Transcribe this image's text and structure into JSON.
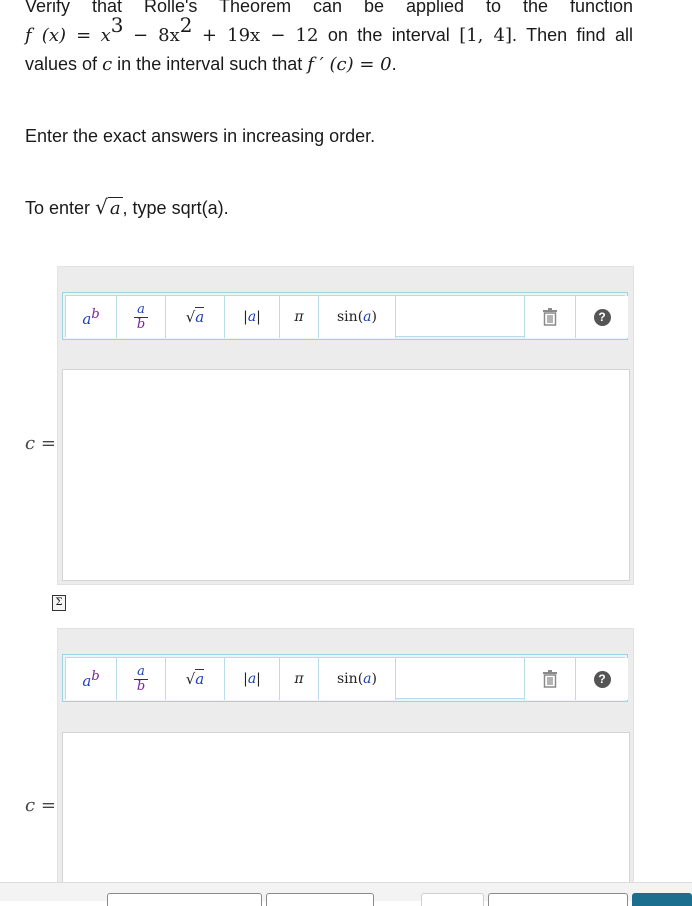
{
  "problem": {
    "line1_prefix": "Verify that Rolle's Theorem can be applied to the function",
    "func": {
      "lhs": "f (x) =",
      "x3_base": "x",
      "x3_exp": "3",
      "term2_pre": "− 8x",
      "x2_exp": "2",
      "term_rest": "+ 19x − 12"
    },
    "on_interval_text": "on the interval",
    "interval": "[1, 4]",
    "then_text": ". Then find all",
    "line3_prefix": "values of",
    "var_c": "c",
    "line3_mid": "in the interval such that",
    "condition": "f ′ (c) = 0",
    "period": "."
  },
  "instruction": "Enter the exact answers in increasing order.",
  "hint": {
    "prefix": "To enter",
    "sqrt_arg": "a",
    "suffix": ", type sqrt(a)."
  },
  "toolbar": {
    "power": {
      "base": "a",
      "exp": "b"
    },
    "fraction": {
      "num": "a",
      "den": "b"
    },
    "sqrt": {
      "sym": "√",
      "arg": "a"
    },
    "abs": {
      "left": "|",
      "arg": "a",
      "right": "|"
    },
    "pi": "π",
    "sin": {
      "fn": "sin",
      "open": "(",
      "arg": "a",
      "close": ")"
    },
    "trash": "🗑",
    "help": "?"
  },
  "answer_label": {
    "var": "c",
    "eq": "="
  },
  "sigma_symbol": "Σ"
}
